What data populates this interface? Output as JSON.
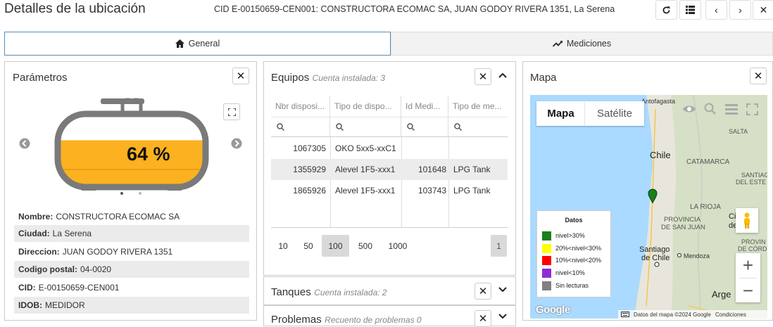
{
  "header": {
    "title": "Detalles de la ubicación",
    "cid_line": "CID E-00150659-CEN001: CONSTRUCTORA ECOMAC SA, JUAN GODOY RIVERA 1351, La Serena",
    "buttons": {
      "refresh": "⟳",
      "list": "☰",
      "prev": "‹",
      "next": "›",
      "close": "✕"
    }
  },
  "tabs": [
    {
      "label": "General",
      "icon": "home-icon",
      "active": true
    },
    {
      "label": "Mediciones",
      "icon": "chart-line-icon",
      "active": false
    }
  ],
  "parametros": {
    "title": "Parámetros",
    "tank_level_percent": 64,
    "tank_level_label": "64 %",
    "tank_fill_color": "#fbb120",
    "carousel_dots": 2,
    "rows": [
      {
        "label": "Nombre:",
        "value": "CONSTRUCTORA ECOMAC SA"
      },
      {
        "label": "Ciudad:",
        "value": "La Serena"
      },
      {
        "label": "Direccion:",
        "value": "JUAN GODOY RIVERA 1351"
      },
      {
        "label": "Codigo postal:",
        "value": "04-0020"
      },
      {
        "label": "CID:",
        "value": "E-00150659-CEN001"
      },
      {
        "label": "IDOB:",
        "value": "MEDIDOR"
      }
    ]
  },
  "equipos": {
    "title": "Equipos",
    "subtitle": "Cuenta instalada: 3",
    "columns": [
      "Nbr disposi...",
      "Tipo de dispo...",
      "Id Medi...",
      "Tipo de me..."
    ],
    "rows": [
      {
        "nbr": "1067305",
        "tipo": "OKO 5xx5-xxC1",
        "id": "",
        "tipo_me": ""
      },
      {
        "nbr": "1355929",
        "tipo": "Alevel 1F5-xxx1",
        "id": "101648",
        "tipo_me": "LPG Tank"
      },
      {
        "nbr": "1865926",
        "tipo": "Alevel 1F5-xxx1",
        "id": "103743",
        "tipo_me": "LPG Tank"
      }
    ],
    "page_sizes": [
      "10",
      "50",
      "100",
      "500",
      "1000"
    ],
    "active_page_size": "100",
    "current_page": "1"
  },
  "tanques": {
    "title": "Tanques",
    "subtitle": "Cuenta instalada: 2"
  },
  "problemas": {
    "title": "Problemas",
    "subtitle": "Recuento de problemas 0"
  },
  "mapa": {
    "title": "Mapa",
    "map_type_buttons": [
      "Mapa",
      "Satélite"
    ],
    "place_labels": [
      "Antofagasta",
      "SALTA",
      "Chile",
      "CATAMARCA",
      "SANTIAG",
      "DEL ESTE",
      "LA RIOJA",
      "PROVINCIA",
      "DE SAN JUAN",
      "Ci",
      "de",
      "PROVIN",
      "DE CÓRDO",
      "Santiago",
      "de Chile",
      "Mendoza",
      "Arge"
    ],
    "legend": {
      "title": "Datos",
      "items": [
        {
          "color": "#1a7f1a",
          "label": "nivel>30%"
        },
        {
          "color": "#ffff00",
          "label": "20%<nivel<30%"
        },
        {
          "color": "#ff0000",
          "label": "10%<nivel<20%"
        },
        {
          "color": "#8e2bd6",
          "label": "nivel<10%"
        },
        {
          "color": "#808080",
          "label": "Sin lecturas"
        }
      ]
    },
    "attribution": "Datos del mapa ©2024 Google",
    "terms": "Condiciones",
    "google_logo": "Google",
    "zoom_in": "+",
    "zoom_out": "−"
  }
}
